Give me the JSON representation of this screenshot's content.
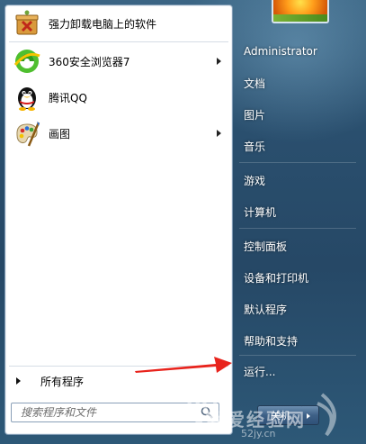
{
  "programs": [
    {
      "label": "强力卸载电脑上的软件",
      "icon": "uninstaller-icon",
      "has_submenu": false
    },
    {
      "label": "360安全浏览器7",
      "icon": "360-browser-icon",
      "has_submenu": true
    },
    {
      "label": "腾讯QQ",
      "icon": "qq-penguin-icon",
      "has_submenu": false
    },
    {
      "label": "画图",
      "icon": "paint-palette-icon",
      "has_submenu": true
    }
  ],
  "all_programs_label": "所有程序",
  "search": {
    "placeholder": "搜索程序和文件"
  },
  "user": {
    "name": "Administrator"
  },
  "right_items": [
    {
      "label": "文档"
    },
    {
      "label": "图片"
    },
    {
      "label": "音乐"
    },
    {
      "label": "游戏"
    },
    {
      "label": "计算机"
    },
    {
      "label": "控制面板"
    },
    {
      "label": "设备和打印机"
    },
    {
      "label": "默认程序"
    },
    {
      "label": "帮助和支持"
    },
    {
      "label": "运行..."
    }
  ],
  "shutdown_label": "关机",
  "watermark": {
    "text": "我爱经验网",
    "sub": "52jy.cn"
  },
  "colors": {
    "annotation_arrow": "#e8231c",
    "menu_bg": "#2a4f6e"
  }
}
